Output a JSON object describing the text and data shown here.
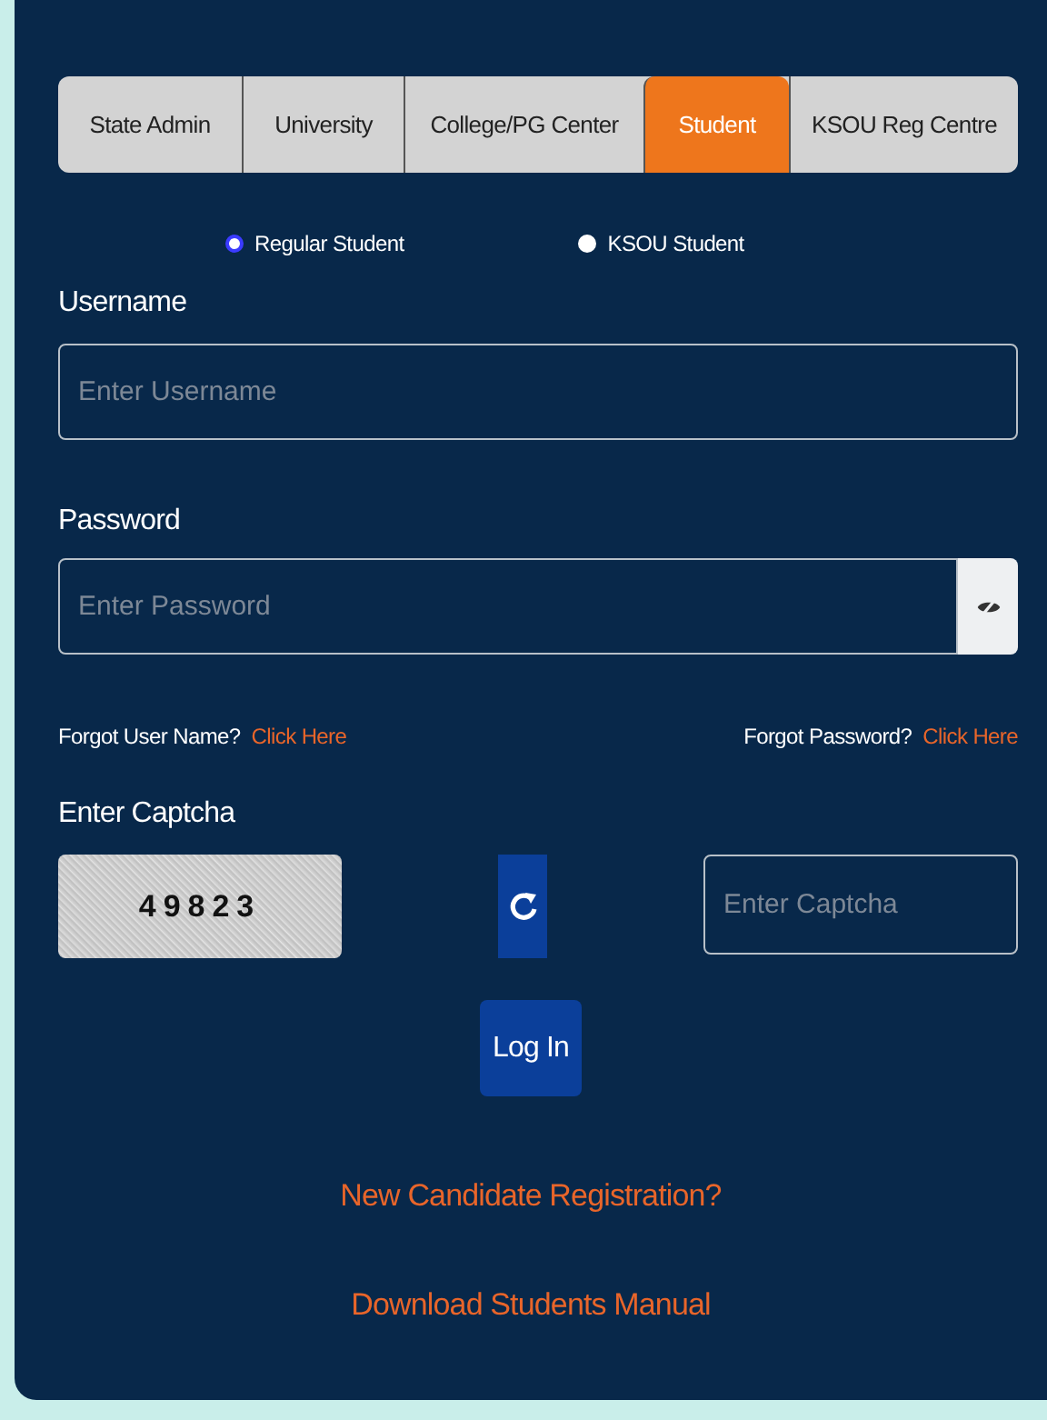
{
  "tabs": [
    {
      "label": "State Admin",
      "selected": false
    },
    {
      "label": "University",
      "selected": false
    },
    {
      "label": "College/PG Center",
      "selected": false
    },
    {
      "label": "Student",
      "selected": true
    },
    {
      "label": "KSOU Reg Centre",
      "selected": false
    }
  ],
  "student_type": [
    {
      "label": "Regular Student",
      "selected": true
    },
    {
      "label": "KSOU Student",
      "selected": false
    }
  ],
  "username": {
    "label": "Username",
    "placeholder": "Enter Username"
  },
  "password": {
    "label": "Password",
    "placeholder": "Enter Password"
  },
  "forgot_username": {
    "text": "Forgot User Name?",
    "link": "Click Here"
  },
  "forgot_password": {
    "text": "Forgot Password?",
    "link": "Click Here"
  },
  "captcha": {
    "label": "Enter Captcha",
    "code": "49823",
    "placeholder": "Enter Captcha"
  },
  "login_button": "Log In",
  "links": [
    "New Candidate Registration?",
    "Download Students Manual"
  ]
}
